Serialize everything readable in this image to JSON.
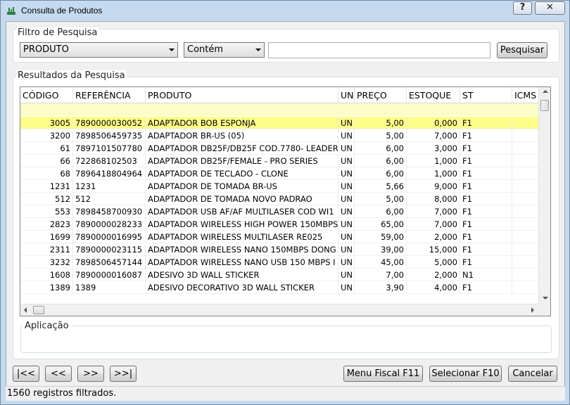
{
  "window": {
    "title": "Consulta de Produtos",
    "help_label": "?",
    "close_label": "✕"
  },
  "filter": {
    "group_title": "Filtro de Pesquisa",
    "field_selected": "PRODUTO",
    "operator_selected": "Contém",
    "search_value": "",
    "search_button": "Pesquisar"
  },
  "results": {
    "group_title": "Resultados da Pesquisa",
    "columns": [
      "CÓDIGO",
      "REFERÊNCIA",
      "PRODUTO",
      "UN",
      "PREÇO",
      "ESTOQUE",
      "ST",
      "ICMS"
    ],
    "rows": [
      [
        "3005",
        "7890000030052",
        "ADAPTADOR BOB ESPONJA",
        "UN",
        "5,00",
        "0,000",
        "F1"
      ],
      [
        "3200",
        "7898506459735",
        "ADAPTADOR BR-US (05)",
        "UN",
        "5,00",
        "7,000",
        "F1"
      ],
      [
        "61",
        "7897101507780",
        "ADAPTADOR DB25F/DB25F COD.7780- LEADER",
        "UN",
        "6,00",
        "3,000",
        "F1"
      ],
      [
        "66",
        "722868102503",
        "ADAPTADOR DB25F/FEMALE - PRO SERIES",
        "UN",
        "6,00",
        "1,000",
        "F1"
      ],
      [
        "68",
        "7896418804964",
        "ADAPTADOR DE TECLADO - CLONE",
        "UN",
        "6,00",
        "1,000",
        "F1"
      ],
      [
        "1231",
        "1231",
        "ADAPTADOR DE TOMADA BR-US",
        "UN",
        "5,66",
        "9,000",
        "F1"
      ],
      [
        "512",
        "512",
        "ADAPTADOR DE TOMADA NOVO PADRAO",
        "UN",
        "5,00",
        "8,000",
        "F1"
      ],
      [
        "553",
        "7898458700930",
        "ADAPTADOR USB AF/AF MULTILASER COD WI1",
        "UN",
        "6,00",
        "7,000",
        "F1"
      ],
      [
        "2823",
        "7890000028233",
        "ADAPTADOR WIRELESS HIGH POWER 150MBPS",
        "UN",
        "65,00",
        "7,000",
        "F1"
      ],
      [
        "1699",
        "7890000016995",
        "ADAPTADOR WIRELESS MULTILASER RE025",
        "UN",
        "59,00",
        "2,000",
        "F1"
      ],
      [
        "2311",
        "7890000023115",
        "ADAPTADOR WIRELESS NANO 150MBPS DONG",
        "UN",
        "39,00",
        "15,000",
        "F1"
      ],
      [
        "3232",
        "7898506457144",
        "ADAPTADOR WIRELESS NANO USB 150 MBPS I",
        "UN",
        "45,00",
        "5,000",
        "F1"
      ],
      [
        "1608",
        "7890000016087",
        "ADESIVO 3D WALL STICKER",
        "UN",
        "7,00",
        "2,000",
        "N1"
      ],
      [
        "1389",
        "1389",
        "ADESIVO DECORATIVO 3D WALL STICKER",
        "UN",
        "3,90",
        "4,000",
        "F1"
      ]
    ]
  },
  "aplicacao": {
    "group_title": "Aplicação"
  },
  "nav": {
    "first": "|<<",
    "prev": "<<",
    "next": ">>",
    "last": ">>|"
  },
  "actions": {
    "menu_fiscal": "Menu Fiscal F11",
    "selecionar": "Selecionar F10",
    "cancelar": "Cancelar"
  },
  "status": {
    "text": "1560 registros filtrados."
  },
  "colors": {
    "selected_row": "#fdfd8a",
    "filter_row": "#fdfdc8",
    "window_frame": "#c5d9ef"
  }
}
